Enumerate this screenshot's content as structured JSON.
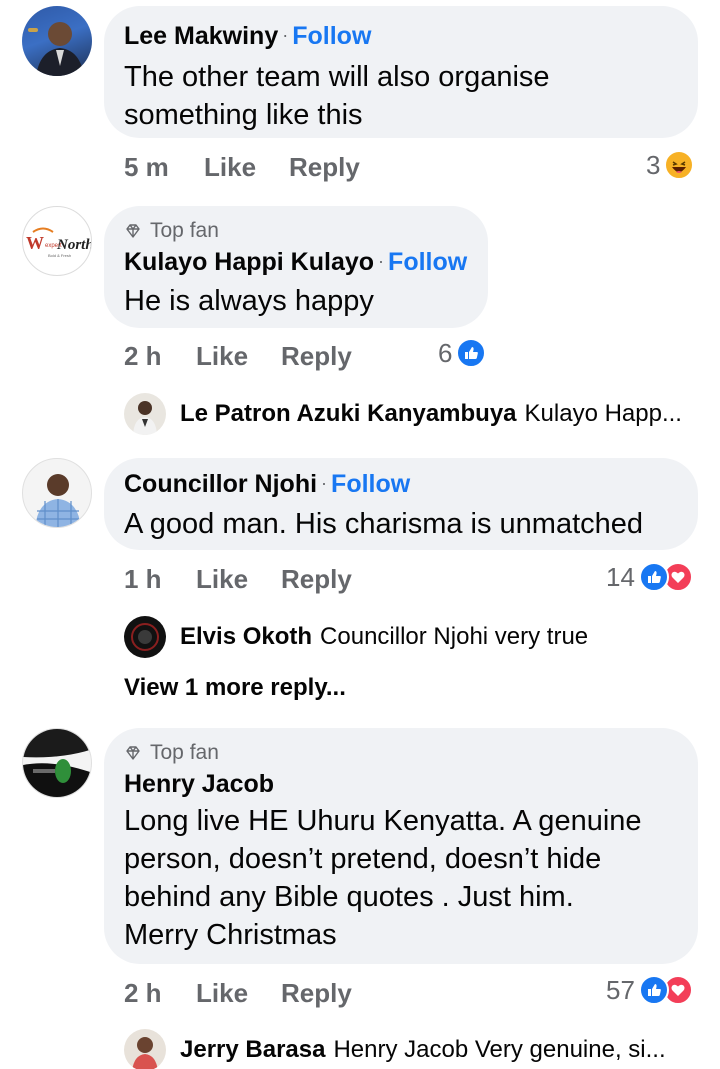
{
  "follow_label": "Follow",
  "separator": "·",
  "like_label": "Like",
  "reply_label": "Reply",
  "comments": [
    {
      "author": "Lee Makwiny",
      "text_lines": [
        "The other team will also organise",
        "something like this"
      ],
      "time": "5 m",
      "reaction_count": "3",
      "reactions": [
        "haha-icon"
      ]
    },
    {
      "badge": "Top fan",
      "author": "Kulayo Happi Kulayo",
      "avatar_text": "Wexpert North",
      "text_lines": [
        "He is always happy"
      ],
      "time": "2 h",
      "reaction_count": "6",
      "reactions": [
        "like-icon"
      ],
      "reply": {
        "author": "Le Patron Azuki Kanyambuya",
        "text": "Kulayo Happ..."
      }
    },
    {
      "author": "Councillor Njohi",
      "text_lines": [
        "A good man. His charisma is unmatched"
      ],
      "time": "1 h",
      "reaction_count": "14",
      "reactions": [
        "like-icon",
        "love-icon"
      ],
      "reply": {
        "author": "Elvis Okoth",
        "text": "Councillor Njohi very true"
      },
      "more_replies": "View 1 more reply..."
    },
    {
      "badge": "Top fan",
      "author": "Henry Jacob",
      "text_lines": [
        "Long live HE Uhuru Kenyatta. A genuine",
        "person, doesn’t pretend, doesn’t hide",
        "behind any Bible quotes . Just him.",
        "Merry Christmas"
      ],
      "time": "2 h",
      "reaction_count": "57",
      "reactions": [
        "like-icon",
        "love-icon"
      ],
      "reply": {
        "author": "Jerry Barasa",
        "text": "Henry Jacob Very genuine, si..."
      }
    }
  ],
  "colors": {
    "accent": "#1877f2",
    "bubble": "#f0f2f5",
    "meta": "#65676b",
    "love": "#f33e58",
    "haha": "#f7b125"
  }
}
